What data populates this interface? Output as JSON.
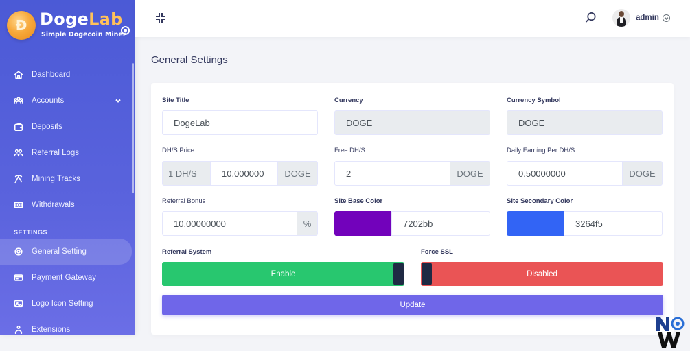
{
  "brand": {
    "name_part1": "Doge",
    "name_part2": "Lab",
    "tagline": "Simple Dogecoin Miner"
  },
  "sidebar": {
    "items": [
      {
        "label": "Dashboard",
        "icon": "home-icon"
      },
      {
        "label": "Accounts",
        "icon": "users-icon",
        "has_chevron": true
      },
      {
        "label": "Deposits",
        "icon": "wallet-icon"
      },
      {
        "label": "Referral Logs",
        "icon": "referral-icon"
      },
      {
        "label": "Mining Tracks",
        "icon": "pickaxe-icon"
      },
      {
        "label": "Withdrawals",
        "icon": "money-icon"
      }
    ],
    "section_heading": "SETTINGS",
    "settings_items": [
      {
        "label": "General Setting",
        "icon": "gear-icon",
        "active": true
      },
      {
        "label": "Payment Gateway",
        "icon": "card-icon"
      },
      {
        "label": "Logo Icon Setting",
        "icon": "image-icon"
      },
      {
        "label": "Extensions",
        "icon": "puzzle-icon"
      }
    ]
  },
  "header": {
    "user_name": "admin"
  },
  "page": {
    "title": "General Settings"
  },
  "form": {
    "site_title": {
      "label": "Site Title",
      "value": "DogeLab"
    },
    "currency": {
      "label": "Currency",
      "value": "DOGE"
    },
    "currency_symbol": {
      "label": "Currency Symbol",
      "value": "DOGE"
    },
    "dhs_price": {
      "label": "DH/S Price",
      "prefix": "1 DH/S =",
      "value": "10.000000",
      "suffix": "DOGE"
    },
    "free_dhs": {
      "label": "Free DH/S",
      "value": "2",
      "suffix": "DOGE"
    },
    "daily_earning": {
      "label": "Daily Earning Per DH/S",
      "value": "0.50000000",
      "suffix": "DOGE"
    },
    "referral_bonus": {
      "label": "Referral Bonus",
      "value": "10.00000000",
      "suffix": "%"
    },
    "base_color": {
      "label": "Site Base Color",
      "value": "7202bb",
      "swatch": "#7202bb"
    },
    "secondary_color": {
      "label": "Site Secondary Color",
      "value": "3264f5",
      "swatch": "#3264f5"
    },
    "referral_system": {
      "label": "Referral System",
      "state": "Enable",
      "color": "#28c76f"
    },
    "force_ssl": {
      "label": "Force SSL",
      "state": "Disabled",
      "color": "#ea5455"
    },
    "update_label": "Update"
  },
  "colors": {
    "sidebar": "#4b5ad6",
    "primary": "#6f66e9"
  }
}
